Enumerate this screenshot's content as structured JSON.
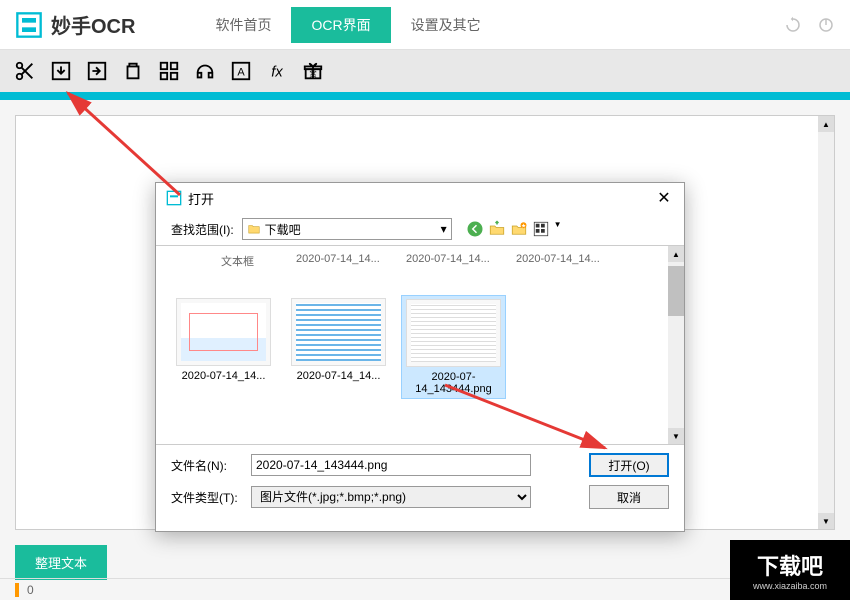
{
  "app": {
    "title": "妙手OCR",
    "nav": {
      "home": "软件首页",
      "ocr": "OCR界面",
      "settings": "设置及其它"
    }
  },
  "toolbar_icons": [
    "scissors",
    "arrow-down",
    "arrow-right",
    "trash",
    "qrcode",
    "headphones",
    "text-a",
    "fx",
    "gift"
  ],
  "dialog": {
    "title": "打开",
    "lookup_label": "查找范围(I):",
    "location": "下载吧",
    "top_row": {
      "folder_label": "文本框",
      "items": [
        "2020-07-14_14...",
        "2020-07-14_14...",
        "2020-07-14_14..."
      ]
    },
    "files": [
      {
        "name": "2020-07-14_14...",
        "selected": false
      },
      {
        "name": "2020-07-14_14...",
        "selected": false
      },
      {
        "name": "2020-07-14_143444.png",
        "selected": true
      }
    ],
    "filename_label": "文件名(N):",
    "filename_value": "2020-07-14_143444.png",
    "filetype_label": "文件类型(T):",
    "filetype_value": "图片文件(*.jpg;*.bmp;*.png)",
    "open_btn": "打开(O)",
    "cancel_btn": "取消"
  },
  "bottom": {
    "tidy_btn": "整理文本",
    "status_count": "0"
  },
  "watermark": {
    "title": "下载吧",
    "url": "www.xiazaiba.com"
  }
}
